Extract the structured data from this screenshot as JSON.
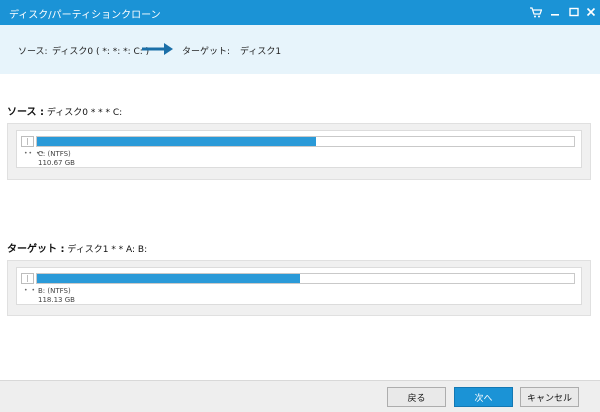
{
  "window": {
    "title": "ディスク/パーティションクローン",
    "icons": [
      "cart-icon",
      "minimize-icon",
      "maximize-icon",
      "close-icon"
    ]
  },
  "path": {
    "source_label": "ソース:",
    "source_value": "ディスク0 ( *: *: *: C: )",
    "target_label": "ターゲット:",
    "target_value": "ディスク1"
  },
  "source": {
    "heading": "ソース :",
    "detail": "ディスク0 * * * C:",
    "partition_name": "C: (NTFS)",
    "partition_size": "110.67 GB",
    "dots": "•• ••",
    "fill_percent": 52
  },
  "target": {
    "heading": "ターゲット :",
    "detail": "ディスク1 * * A: B:",
    "partition_name": "B: (NTFS)",
    "partition_size": "118.13 GB",
    "dots": "• •",
    "fill_percent": 49
  },
  "buttons": {
    "back": "戻る",
    "next": "次へ",
    "cancel": "キャンセル"
  },
  "colors": {
    "accent": "#1b93d6",
    "bar": "#2a9ad8",
    "pathbar_bg": "#e7f4fb"
  }
}
